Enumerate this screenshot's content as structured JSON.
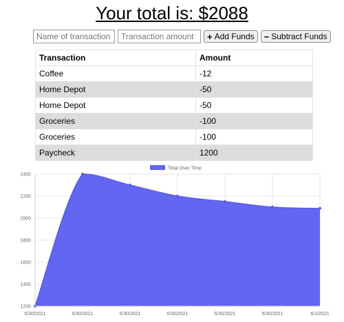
{
  "header": {
    "title": "Your total is: $2088"
  },
  "form": {
    "name_placeholder": "Name of transaction",
    "amount_placeholder": "Transaction amount",
    "add_label": "Add Funds",
    "subtract_label": "Subtract Funds"
  },
  "table": {
    "headers": [
      "Transaction",
      "Amount"
    ],
    "rows": [
      [
        "Coffee",
        "-12"
      ],
      [
        "Home Depot",
        "-50"
      ],
      [
        "Home Depot",
        "-50"
      ],
      [
        "Groceries",
        "-100"
      ],
      [
        "Groceries",
        "-100"
      ],
      [
        "Paycheck",
        "1200"
      ]
    ]
  },
  "chart_data": {
    "type": "area",
    "legend": "Total Over Time",
    "legend_position": "top",
    "categories": [
      "5/30/2021",
      "5/30/2021",
      "5/30/2021",
      "5/30/2021",
      "5/30/2021",
      "5/30/2021",
      "6/1/2021"
    ],
    "values": [
      1200,
      2400,
      2300,
      2200,
      2150,
      2100,
      2088
    ],
    "ylim": [
      1200,
      2400
    ],
    "yticks": [
      "1200",
      "1400",
      "1600",
      "1800",
      "2000",
      "2200",
      "2400"
    ],
    "grid": true,
    "fill_color": "#6366f1",
    "line_color": "#5b5be0"
  }
}
